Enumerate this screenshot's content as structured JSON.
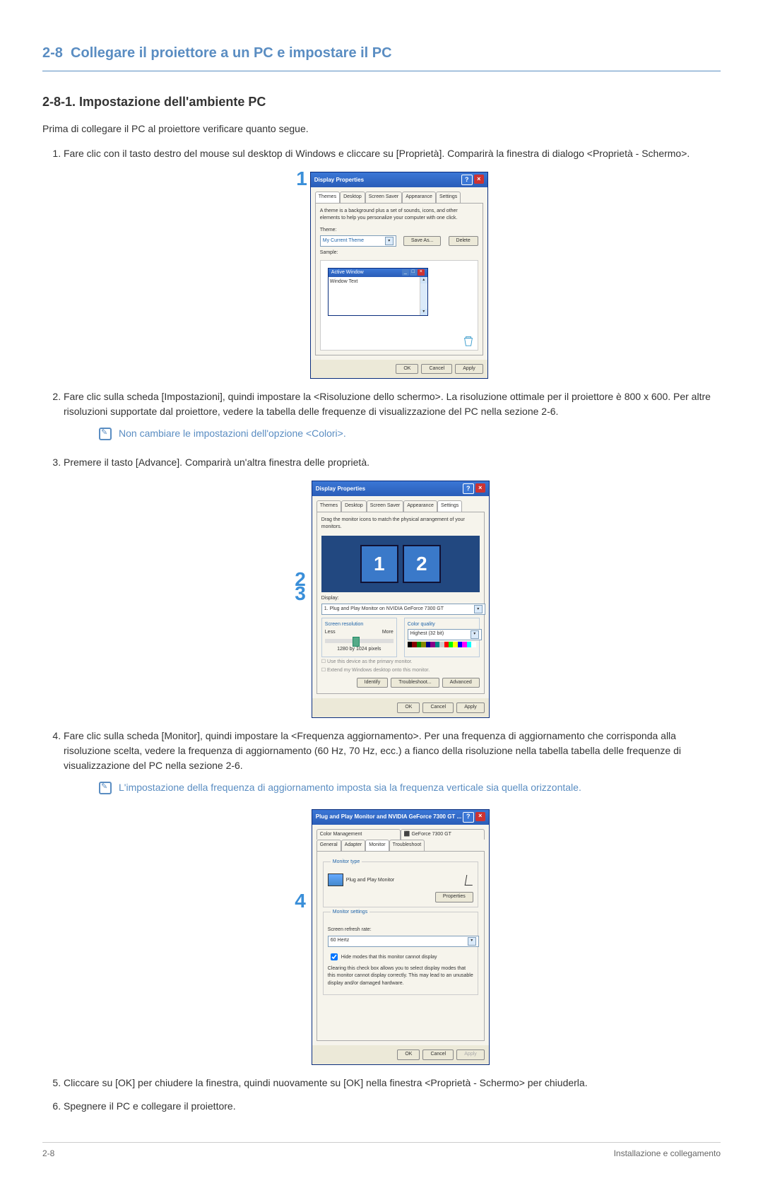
{
  "section": {
    "number": "2-8",
    "title": "Collegare il proiettore a un PC e impostare il PC"
  },
  "subhead": "2-8-1. Impostazione dell'ambiente PC",
  "intro": "Prima di collegare il PC al proiettore verificare quanto segue.",
  "steps": {
    "s1": {
      "num": "1.",
      "text": "Fare clic con il tasto destro del mouse sul desktop di Windows e cliccare su [Proprietà]. Comparirà la finestra di dialogo <Proprietà - Schermo>."
    },
    "s2": {
      "num": "2.",
      "text": "Fare clic sulla scheda [Impostazioni], quindi impostare la <Risoluzione dello schermo>. La risoluzione ottimale per il proiettore è 800 x 600. Per altre risoluzioni supportate dal proiettore, vedere la tabella delle frequenze di visualizzazione del PC nella sezione 2-6."
    },
    "s3": {
      "num": "3.",
      "text": "Premere il tasto [Advance]. Comparirà un'altra finestra delle proprietà."
    },
    "s4": {
      "num": "4.",
      "text": "Fare clic sulla scheda [Monitor], quindi impostare la <Frequenza aggiornamento>. Per una frequenza di aggiornamento che corrisponda alla risoluzione scelta, vedere la frequenza di aggiornamento (60 Hz, 70 Hz, ecc.) a fianco della risoluzione nella tabella tabella delle frequenze di visualizzazione del PC nella sezione 2-6."
    },
    "s5": {
      "num": "5.",
      "text": "Cliccare su [OK] per chiudere la finestra, quindi nuovamente su [OK] nella finestra <Proprietà - Schermo> per chiuderla."
    },
    "s6": {
      "num": "6.",
      "text": "Spegnere il PC e collegare il proiettore."
    }
  },
  "notes": {
    "n1": "Non cambiare le impostazioni dell'opzione <Colori>.",
    "n2": "L'impostazione della frequenza di aggiornamento imposta sia la frequenza verticale sia quella orizzontale."
  },
  "markers": {
    "m1": "1",
    "m2": "2",
    "m3": "3",
    "m4": "4"
  },
  "dlg1": {
    "title": "Display Properties",
    "tabs": [
      "Themes",
      "Desktop",
      "Screen Saver",
      "Appearance",
      "Settings"
    ],
    "desc": "A theme is a background plus a set of sounds, icons, and other elements to help you personalize your computer with one click.",
    "theme_lbl": "Theme:",
    "theme_val": "My Current Theme",
    "save_as": "Save As...",
    "delete": "Delete",
    "sample_lbl": "Sample:",
    "active_window": "Active Window",
    "window_text": "Window Text",
    "ok": "OK",
    "cancel": "Cancel",
    "apply": "Apply"
  },
  "dlg2": {
    "title": "Display Properties",
    "tabs": [
      "Themes",
      "Desktop",
      "Screen Saver",
      "Appearance",
      "Settings"
    ],
    "desc": "Drag the monitor icons to match the physical arrangement of your monitors.",
    "display_lbl": "Display:",
    "display_val": "1. Plug and Play Monitor on NVIDIA GeForce 7300 GT",
    "res_lbl": "Screen resolution",
    "less": "Less",
    "more": "More",
    "res_val": "1280 by 1024 pixels",
    "color_lbl": "Color quality",
    "color_val": "Highest (32 bit)",
    "chk1": "Use this device as the primary monitor.",
    "chk2": "Extend my Windows desktop onto this monitor.",
    "identify": "Identify",
    "troubleshoot": "Troubleshoot...",
    "advanced": "Advanced",
    "ok": "OK",
    "cancel": "Cancel",
    "apply": "Apply",
    "mon1": "1",
    "mon2": "2"
  },
  "dlg3": {
    "title": "Plug and Play Monitor and NVIDIA GeForce 7300 GT ...",
    "tabs_top": [
      "Color Management",
      "GeForce 7300 GT"
    ],
    "tabs_bot": [
      "General",
      "Adapter",
      "Monitor",
      "Troubleshoot"
    ],
    "geforce_icon": "🟩",
    "montype_lbl": "Monitor type",
    "montype_val": "Plug and Play Monitor",
    "properties": "Properties",
    "monset_lbl": "Monitor settings",
    "refresh_lbl": "Screen refresh rate:",
    "refresh_val": "60 Hertz",
    "hide_chk": "Hide modes that this monitor cannot display",
    "hide_desc": "Clearing this check box allows you to select display modes that this monitor cannot display correctly. This may lead to an unusable display and/or damaged hardware.",
    "ok": "OK",
    "cancel": "Cancel",
    "apply": "Apply"
  },
  "footer": {
    "left": "2-8",
    "right": "Installazione e collegamento"
  }
}
